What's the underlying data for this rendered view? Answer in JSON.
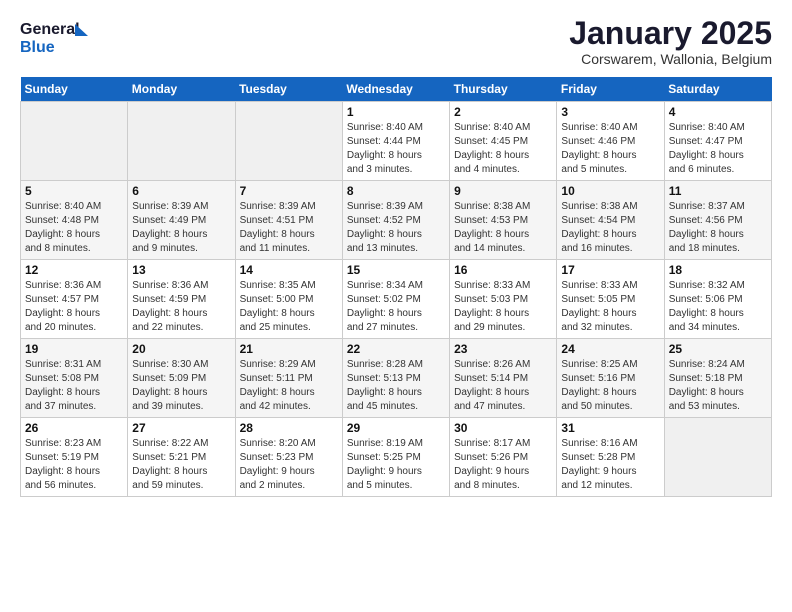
{
  "header": {
    "logo_line1": "General",
    "logo_line2": "Blue",
    "title": "January 2025",
    "subtitle": "Corswarem, Wallonia, Belgium"
  },
  "weekdays": [
    "Sunday",
    "Monday",
    "Tuesday",
    "Wednesday",
    "Thursday",
    "Friday",
    "Saturday"
  ],
  "weeks": [
    [
      {
        "day": "",
        "info": ""
      },
      {
        "day": "",
        "info": ""
      },
      {
        "day": "",
        "info": ""
      },
      {
        "day": "1",
        "info": "Sunrise: 8:40 AM\nSunset: 4:44 PM\nDaylight: 8 hours\nand 3 minutes."
      },
      {
        "day": "2",
        "info": "Sunrise: 8:40 AM\nSunset: 4:45 PM\nDaylight: 8 hours\nand 4 minutes."
      },
      {
        "day": "3",
        "info": "Sunrise: 8:40 AM\nSunset: 4:46 PM\nDaylight: 8 hours\nand 5 minutes."
      },
      {
        "day": "4",
        "info": "Sunrise: 8:40 AM\nSunset: 4:47 PM\nDaylight: 8 hours\nand 6 minutes."
      }
    ],
    [
      {
        "day": "5",
        "info": "Sunrise: 8:40 AM\nSunset: 4:48 PM\nDaylight: 8 hours\nand 8 minutes."
      },
      {
        "day": "6",
        "info": "Sunrise: 8:39 AM\nSunset: 4:49 PM\nDaylight: 8 hours\nand 9 minutes."
      },
      {
        "day": "7",
        "info": "Sunrise: 8:39 AM\nSunset: 4:51 PM\nDaylight: 8 hours\nand 11 minutes."
      },
      {
        "day": "8",
        "info": "Sunrise: 8:39 AM\nSunset: 4:52 PM\nDaylight: 8 hours\nand 13 minutes."
      },
      {
        "day": "9",
        "info": "Sunrise: 8:38 AM\nSunset: 4:53 PM\nDaylight: 8 hours\nand 14 minutes."
      },
      {
        "day": "10",
        "info": "Sunrise: 8:38 AM\nSunset: 4:54 PM\nDaylight: 8 hours\nand 16 minutes."
      },
      {
        "day": "11",
        "info": "Sunrise: 8:37 AM\nSunset: 4:56 PM\nDaylight: 8 hours\nand 18 minutes."
      }
    ],
    [
      {
        "day": "12",
        "info": "Sunrise: 8:36 AM\nSunset: 4:57 PM\nDaylight: 8 hours\nand 20 minutes."
      },
      {
        "day": "13",
        "info": "Sunrise: 8:36 AM\nSunset: 4:59 PM\nDaylight: 8 hours\nand 22 minutes."
      },
      {
        "day": "14",
        "info": "Sunrise: 8:35 AM\nSunset: 5:00 PM\nDaylight: 8 hours\nand 25 minutes."
      },
      {
        "day": "15",
        "info": "Sunrise: 8:34 AM\nSunset: 5:02 PM\nDaylight: 8 hours\nand 27 minutes."
      },
      {
        "day": "16",
        "info": "Sunrise: 8:33 AM\nSunset: 5:03 PM\nDaylight: 8 hours\nand 29 minutes."
      },
      {
        "day": "17",
        "info": "Sunrise: 8:33 AM\nSunset: 5:05 PM\nDaylight: 8 hours\nand 32 minutes."
      },
      {
        "day": "18",
        "info": "Sunrise: 8:32 AM\nSunset: 5:06 PM\nDaylight: 8 hours\nand 34 minutes."
      }
    ],
    [
      {
        "day": "19",
        "info": "Sunrise: 8:31 AM\nSunset: 5:08 PM\nDaylight: 8 hours\nand 37 minutes."
      },
      {
        "day": "20",
        "info": "Sunrise: 8:30 AM\nSunset: 5:09 PM\nDaylight: 8 hours\nand 39 minutes."
      },
      {
        "day": "21",
        "info": "Sunrise: 8:29 AM\nSunset: 5:11 PM\nDaylight: 8 hours\nand 42 minutes."
      },
      {
        "day": "22",
        "info": "Sunrise: 8:28 AM\nSunset: 5:13 PM\nDaylight: 8 hours\nand 45 minutes."
      },
      {
        "day": "23",
        "info": "Sunrise: 8:26 AM\nSunset: 5:14 PM\nDaylight: 8 hours\nand 47 minutes."
      },
      {
        "day": "24",
        "info": "Sunrise: 8:25 AM\nSunset: 5:16 PM\nDaylight: 8 hours\nand 50 minutes."
      },
      {
        "day": "25",
        "info": "Sunrise: 8:24 AM\nSunset: 5:18 PM\nDaylight: 8 hours\nand 53 minutes."
      }
    ],
    [
      {
        "day": "26",
        "info": "Sunrise: 8:23 AM\nSunset: 5:19 PM\nDaylight: 8 hours\nand 56 minutes."
      },
      {
        "day": "27",
        "info": "Sunrise: 8:22 AM\nSunset: 5:21 PM\nDaylight: 8 hours\nand 59 minutes."
      },
      {
        "day": "28",
        "info": "Sunrise: 8:20 AM\nSunset: 5:23 PM\nDaylight: 9 hours\nand 2 minutes."
      },
      {
        "day": "29",
        "info": "Sunrise: 8:19 AM\nSunset: 5:25 PM\nDaylight: 9 hours\nand 5 minutes."
      },
      {
        "day": "30",
        "info": "Sunrise: 8:17 AM\nSunset: 5:26 PM\nDaylight: 9 hours\nand 8 minutes."
      },
      {
        "day": "31",
        "info": "Sunrise: 8:16 AM\nSunset: 5:28 PM\nDaylight: 9 hours\nand 12 minutes."
      },
      {
        "day": "",
        "info": ""
      }
    ]
  ]
}
